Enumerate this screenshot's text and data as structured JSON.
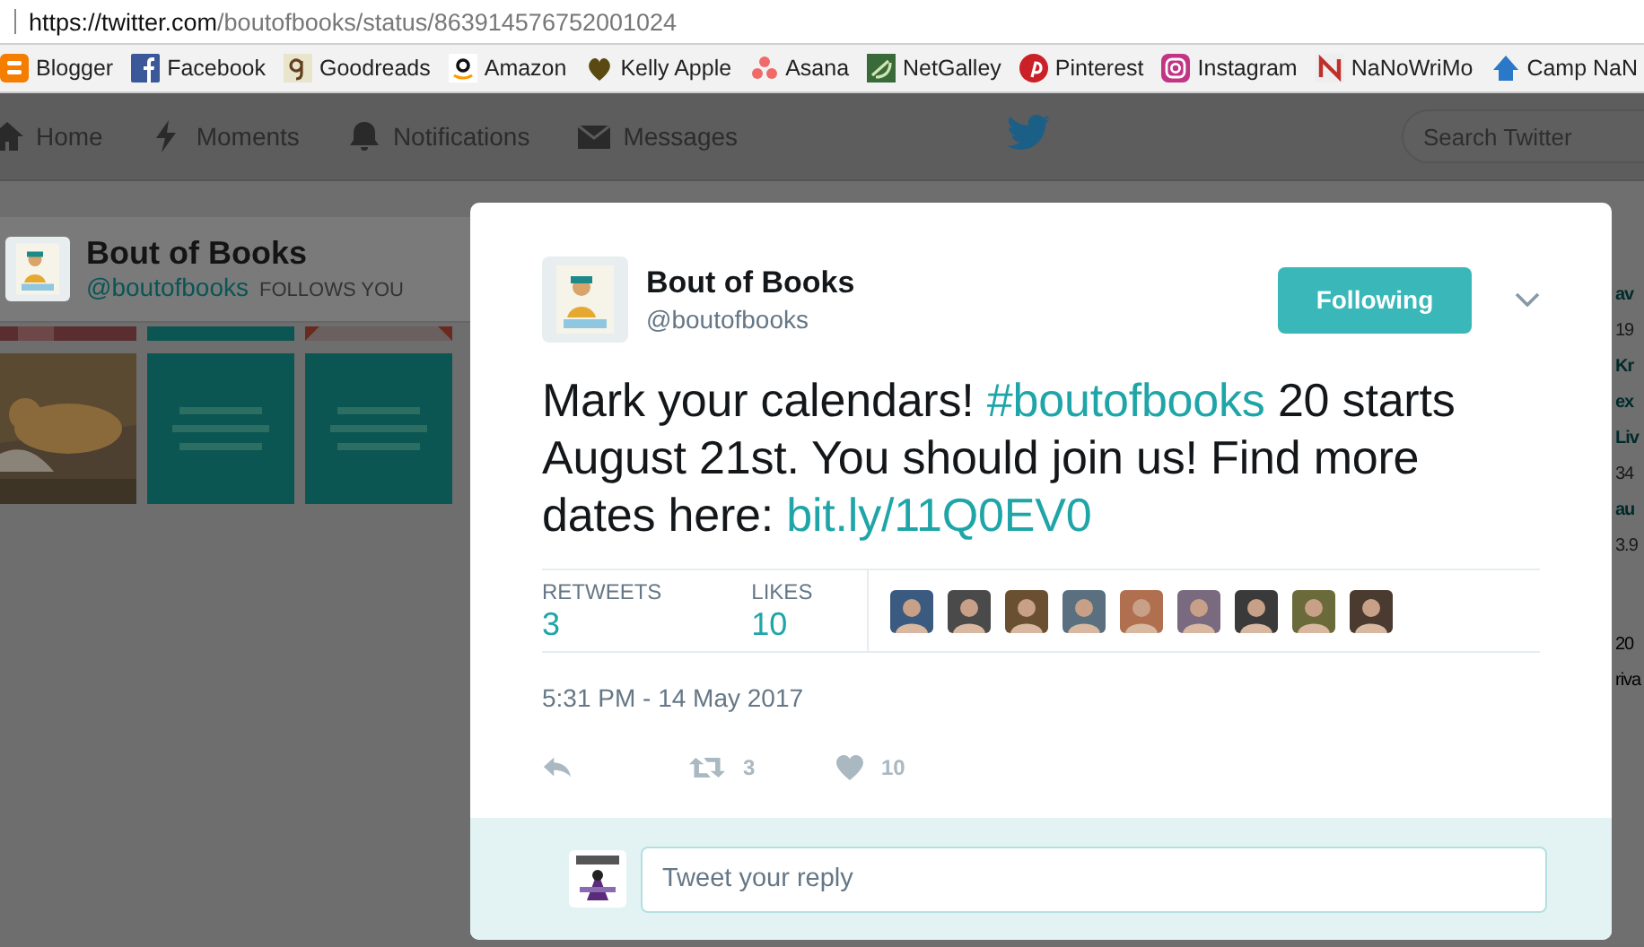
{
  "browser": {
    "url_main": "https://twitter.com",
    "url_rest": "/boutofbooks/status/863914576752001024"
  },
  "bookmarks": [
    {
      "label": "Blogger",
      "kind": "blogger"
    },
    {
      "label": "Facebook",
      "kind": "facebook"
    },
    {
      "label": "Goodreads",
      "kind": "goodreads"
    },
    {
      "label": "Amazon",
      "kind": "amazon"
    },
    {
      "label": "Kelly Apple",
      "kind": "apple"
    },
    {
      "label": "Asana",
      "kind": "asana"
    },
    {
      "label": "NetGalley",
      "kind": "netgalley"
    },
    {
      "label": "Pinterest",
      "kind": "pinterest"
    },
    {
      "label": "Instagram",
      "kind": "instagram"
    },
    {
      "label": "NaNoWriMo",
      "kind": "nano"
    },
    {
      "label": "Camp NaN",
      "kind": "camp"
    }
  ],
  "nav": {
    "items": [
      {
        "label": "Home",
        "kind": "home"
      },
      {
        "label": "Moments",
        "kind": "moments"
      },
      {
        "label": "Notifications",
        "kind": "notifications"
      },
      {
        "label": "Messages",
        "kind": "messages"
      }
    ],
    "search": {
      "placeholder": "Search Twitter"
    }
  },
  "profile": {
    "name": "Bout of Books",
    "handle": "@boutofbooks",
    "follows_you": "FOLLOWS YOU"
  },
  "side_snippets": [
    {
      "text": "av",
      "kind": "link"
    },
    {
      "text": "19",
      "kind": "meta"
    },
    {
      "text": "Kr",
      "kind": "link"
    },
    {
      "text": "ex",
      "kind": "link"
    },
    {
      "text": "Liv",
      "kind": "link"
    },
    {
      "text": "34",
      "kind": "meta"
    },
    {
      "text": "au",
      "kind": "link"
    },
    {
      "text": "3.9",
      "kind": "meta"
    },
    {
      "text": "20",
      "kind": "footer"
    },
    {
      "text": "riva",
      "kind": "footer"
    }
  ],
  "tweet": {
    "name": "Bout of Books",
    "handle": "@boutofbooks",
    "follow_button": "Following",
    "text": [
      {
        "text": "Mark your calendars! ",
        "kind": "plain"
      },
      {
        "text": "#boutofbooks",
        "kind": "hashtag"
      },
      {
        "text": " 20 starts August 21st. You should join us! Find more dates here: ",
        "kind": "plain"
      },
      {
        "text": "bit.ly/11Q0EV0",
        "kind": "link"
      }
    ],
    "stats": [
      {
        "label": "RETWEETS",
        "value": "3"
      },
      {
        "label": "LIKES",
        "value": "10"
      }
    ],
    "timestamp": "5:31 PM - 14 May 2017",
    "actions": [
      {
        "kind": "reply"
      },
      {
        "kind": "retweet",
        "count": "3"
      },
      {
        "kind": "like",
        "count": "10"
      }
    ],
    "reply": {
      "placeholder": "Tweet your reply"
    }
  }
}
